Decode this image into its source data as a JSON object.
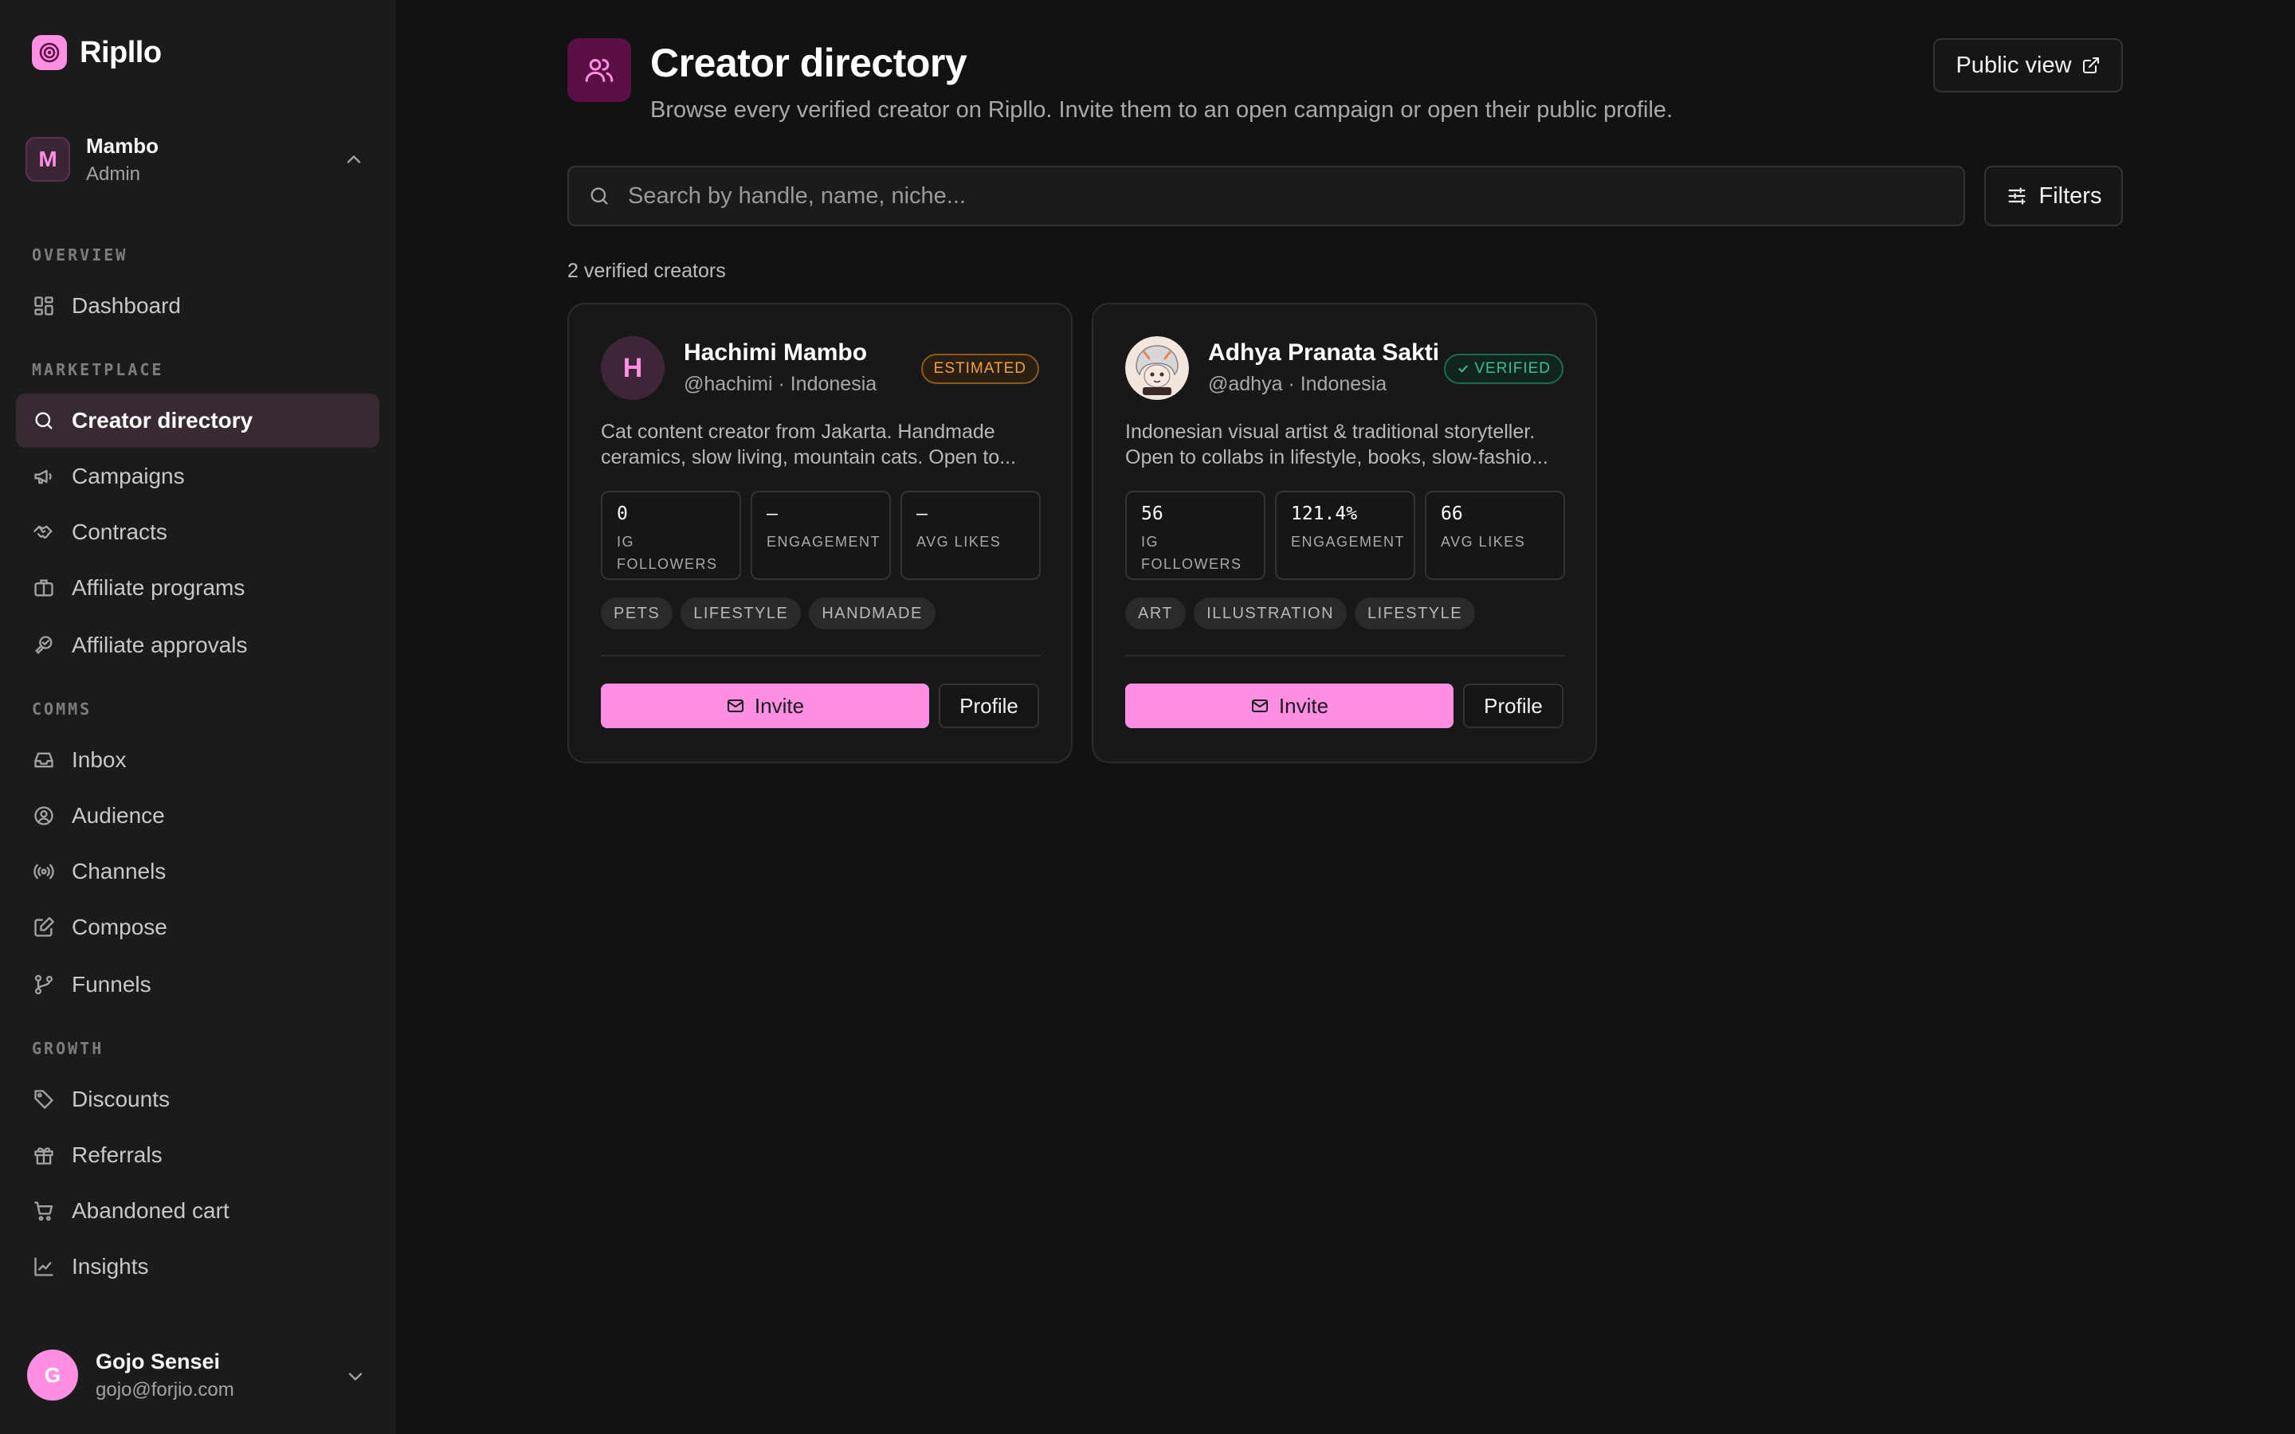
{
  "brand": {
    "name": "Ripllo",
    "accent": "#ff8fe3"
  },
  "workspace": {
    "initial": "M",
    "name": "Mambo",
    "role": "Admin"
  },
  "sidebar": {
    "sections": [
      {
        "title": "OVERVIEW"
      },
      {
        "title": "MARKETPLACE"
      },
      {
        "title": "COMMS"
      },
      {
        "title": "GROWTH"
      }
    ],
    "items": [
      {
        "label": "Dashboard",
        "icon": "dashboard-icon"
      },
      {
        "label": "Creator directory",
        "icon": "search-icon",
        "active": true
      },
      {
        "label": "Campaigns",
        "icon": "megaphone-icon"
      },
      {
        "label": "Contracts",
        "icon": "handshake-icon"
      },
      {
        "label": "Affiliate programs",
        "icon": "briefcase-icon"
      },
      {
        "label": "Affiliate approvals",
        "icon": "link-check-icon"
      },
      {
        "label": "Inbox",
        "icon": "inbox-icon"
      },
      {
        "label": "Audience",
        "icon": "user-circle-icon"
      },
      {
        "label": "Channels",
        "icon": "broadcast-icon"
      },
      {
        "label": "Compose",
        "icon": "edit-icon"
      },
      {
        "label": "Funnels",
        "icon": "git-branch-icon"
      },
      {
        "label": "Discounts",
        "icon": "tag-icon"
      },
      {
        "label": "Referrals",
        "icon": "gift-icon"
      },
      {
        "label": "Abandoned cart",
        "icon": "cart-icon"
      },
      {
        "label": "Insights",
        "icon": "chart-line-icon"
      }
    ]
  },
  "user": {
    "initial": "G",
    "name": "Gojo Sensei",
    "email": "gojo@forjio.com"
  },
  "header": {
    "title": "Creator directory",
    "subtitle": "Browse every verified creator on Ripllo. Invite them to an open campaign or open their public profile.",
    "public_view_label": "Public view"
  },
  "search": {
    "placeholder": "Search by handle, name, niche...",
    "value": ""
  },
  "filters_label": "Filters",
  "results_count": "2 verified creators",
  "creators": [
    {
      "initial": "H",
      "name": "Hachimi Mambo",
      "handle": "@hachimi · Indonesia",
      "badge": "ESTIMATED",
      "desc_lines": [
        "Cat content creator from Jakarta. Handmade",
        "ceramics, slow living, mountain cats. Open to..."
      ],
      "stats": [
        {
          "value": "0",
          "label": "IG FOLLOWERS"
        },
        {
          "value": "—",
          "label": "ENGAGEMENT"
        },
        {
          "value": "—",
          "label": "AVG LIKES"
        }
      ],
      "tags": [
        "PETS",
        "LIFESTYLE",
        "HANDMADE"
      ],
      "invite_label": "Invite",
      "profile_label": "Profile"
    },
    {
      "initial": "",
      "name": "Adhya Pranata Sakti",
      "handle": "@adhya · Indonesia",
      "badge": "VERIFIED",
      "desc_lines": [
        "Indonesian visual artist & traditional storyteller.",
        "Open to collabs in lifestyle, books, slow-fashio..."
      ],
      "stats": [
        {
          "value": "56",
          "label": "IG FOLLOWERS"
        },
        {
          "value": "121.4%",
          "label": "ENGAGEMENT"
        },
        {
          "value": "66",
          "label": "AVG LIKES"
        }
      ],
      "tags": [
        "ART",
        "ILLUSTRATION",
        "LIFESTYLE"
      ],
      "invite_label": "Invite",
      "profile_label": "Profile"
    }
  ]
}
